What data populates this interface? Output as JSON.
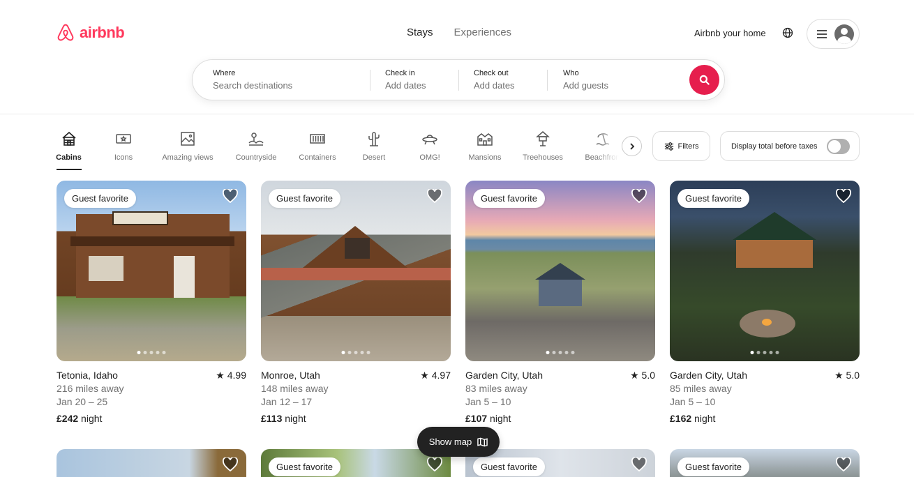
{
  "header": {
    "logo_text": "airbnb",
    "tabs": [
      "Stays",
      "Experiences"
    ],
    "host_link": "Airbnb your home",
    "brand_color": "#ff385c"
  },
  "search": {
    "where_label": "Where",
    "where_placeholder": "Search destinations",
    "checkin_label": "Check in",
    "checkin_value": "Add dates",
    "checkout_label": "Check out",
    "checkout_value": "Add dates",
    "who_label": "Who",
    "who_value": "Add guests"
  },
  "categories": [
    "Cabins",
    "Icons",
    "Amazing views",
    "Countryside",
    "Containers",
    "Desert",
    "OMG!",
    "Mansions",
    "Treehouses",
    "Beachfront"
  ],
  "filters": {
    "filters_label": "Filters",
    "tax_label": "Display total before taxes"
  },
  "listings": [
    {
      "badge": "Guest favorite",
      "location": "Tetonia, Idaho",
      "rating": "4.99",
      "distance": "216 miles away",
      "dates": "Jan 20 – 25",
      "price": "£242",
      "price_unit": "night"
    },
    {
      "badge": "Guest favorite",
      "location": "Monroe, Utah",
      "rating": "4.97",
      "distance": "148 miles away",
      "dates": "Jan 12 – 17",
      "price": "£113",
      "price_unit": "night"
    },
    {
      "badge": "Guest favorite",
      "location": "Garden City, Utah",
      "rating": "5.0",
      "distance": "83 miles away",
      "dates": "Jan 5 – 10",
      "price": "£107",
      "price_unit": "night"
    },
    {
      "badge": "Guest favorite",
      "location": "Garden City, Utah",
      "rating": "5.0",
      "distance": "85 miles away",
      "dates": "Jan 5 – 10",
      "price": "£162",
      "price_unit": "night"
    }
  ],
  "row2_badges": [
    "",
    "Guest favorite",
    "Guest favorite",
    "Guest favorite"
  ],
  "map_button": "Show map"
}
